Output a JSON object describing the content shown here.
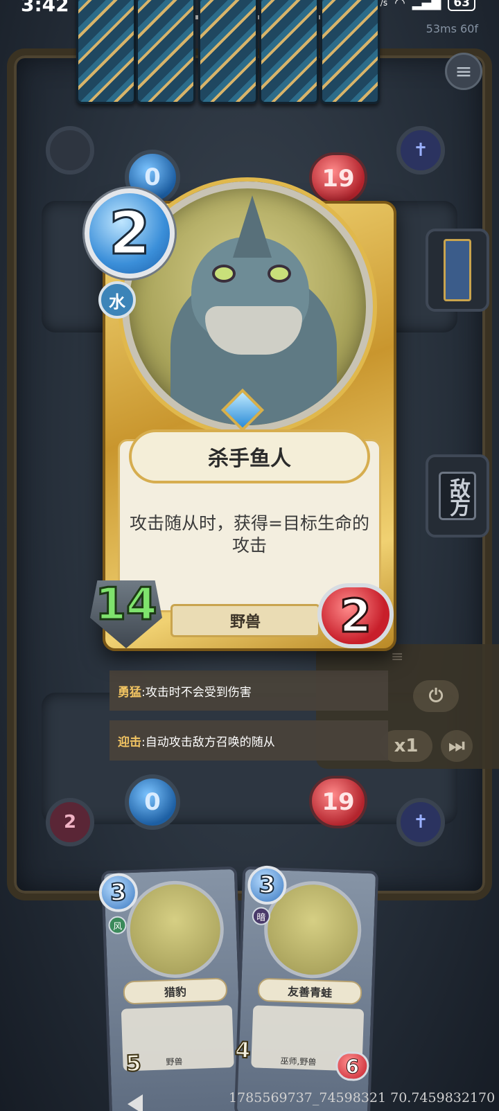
{
  "status_bar": {
    "time": "3:42",
    "network_speed": "K/s",
    "battery": "63",
    "fps": "53ms 60f"
  },
  "board": {
    "opponent": {
      "mana": "0",
      "life": "19"
    },
    "player": {
      "graveyard": "2",
      "mana": "0",
      "life": "19"
    },
    "enemy_label": "敌方",
    "menu_icon": "hamburger-menu-icon",
    "speed_label": "x1"
  },
  "featured_card": {
    "cost": "2",
    "element": "水",
    "name": "杀手鱼人",
    "description": "攻击随从时，获得=目标生命的攻击",
    "attack": "14",
    "health": "2",
    "type": "野兽",
    "color_accent": "#d8b04a"
  },
  "abilities": [
    {
      "keyword": "勇猛",
      "text": ":攻击时不会受到伤害"
    },
    {
      "keyword": "迎击",
      "text": ":自动攻击敌方召唤的随从"
    }
  ],
  "hand": [
    {
      "cost": "3",
      "element": "风",
      "name": "猎豹",
      "type": "野兽",
      "attack": "5",
      "health": ""
    },
    {
      "cost": "3",
      "element": "暗",
      "name": "友善青蛙",
      "type": "巫师,野兽",
      "attack": "4",
      "health": "6"
    }
  ],
  "footer_text": "1785569737_74598321 70.7459832170"
}
